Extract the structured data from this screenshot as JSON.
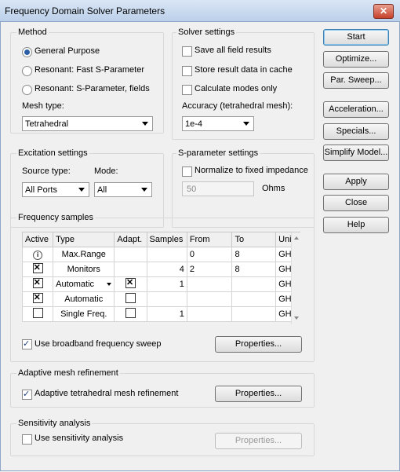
{
  "window": {
    "title": "Frequency Domain Solver Parameters",
    "close_glyph": "✕"
  },
  "method": {
    "title": "Method",
    "options": [
      "General Purpose",
      "Resonant: Fast S-Parameter",
      "Resonant: S-Parameter, fields"
    ],
    "selected": "General Purpose",
    "mesh_type_label": "Mesh type:",
    "mesh_type_value": "Tetrahedral"
  },
  "solver": {
    "title": "Solver settings",
    "save_all": "Save all field results",
    "store_cache": "Store result data in cache",
    "calc_modes": "Calculate modes only",
    "accuracy_label": "Accuracy (tetrahedral mesh):",
    "accuracy_value": "1e-4"
  },
  "excitation": {
    "title": "Excitation settings",
    "source_label": "Source type:",
    "source_value": "All Ports",
    "mode_label": "Mode:",
    "mode_value": "All"
  },
  "sparam": {
    "title": "S-parameter settings",
    "normalize": "Normalize to fixed impedance",
    "impedance_value": "50",
    "impedance_unit": "Ohms"
  },
  "freq": {
    "title": "Frequency samples",
    "columns": [
      "Active",
      "Type",
      "Adapt.",
      "Samples",
      "From",
      "To",
      "Unit"
    ],
    "rows": [
      {
        "active": "info",
        "type": "Max.Range",
        "adapt": "",
        "samples": "",
        "from": "0",
        "to": "8",
        "unit": "GHz"
      },
      {
        "active": "x",
        "type": "Monitors",
        "adapt": "",
        "samples": "4",
        "from": "2",
        "to": "8",
        "unit": "GHz"
      },
      {
        "active": "x",
        "type": "Automatic",
        "adapt": "x",
        "samples": "1",
        "from": "",
        "to": "",
        "unit": "GHz"
      },
      {
        "active": "x",
        "type": "Automatic",
        "adapt": "empty",
        "samples": "",
        "from": "",
        "to": "",
        "unit": "GHz"
      },
      {
        "active": "empty",
        "type": "Single Freq.",
        "adapt": "empty",
        "samples": "1",
        "from": "",
        "to": "",
        "unit": "GHz"
      }
    ],
    "broadband_label": "Use broadband frequency sweep",
    "properties_label": "Properties..."
  },
  "adaptive": {
    "title": "Adaptive mesh refinement",
    "label": "Adaptive tetrahedral mesh refinement",
    "properties_label": "Properties..."
  },
  "sensitivity": {
    "title": "Sensitivity analysis",
    "label": "Use sensitivity analysis",
    "properties_label": "Properties..."
  },
  "buttons": {
    "start": "Start",
    "optimize": "Optimize...",
    "par_sweep": "Par. Sweep...",
    "acceleration": "Acceleration...",
    "specials": "Specials...",
    "simplify": "Simplify Model...",
    "apply": "Apply",
    "close": "Close",
    "help": "Help"
  },
  "colors": {
    "accent": "#2a5fa8",
    "default_border": "#3c7fb1"
  }
}
